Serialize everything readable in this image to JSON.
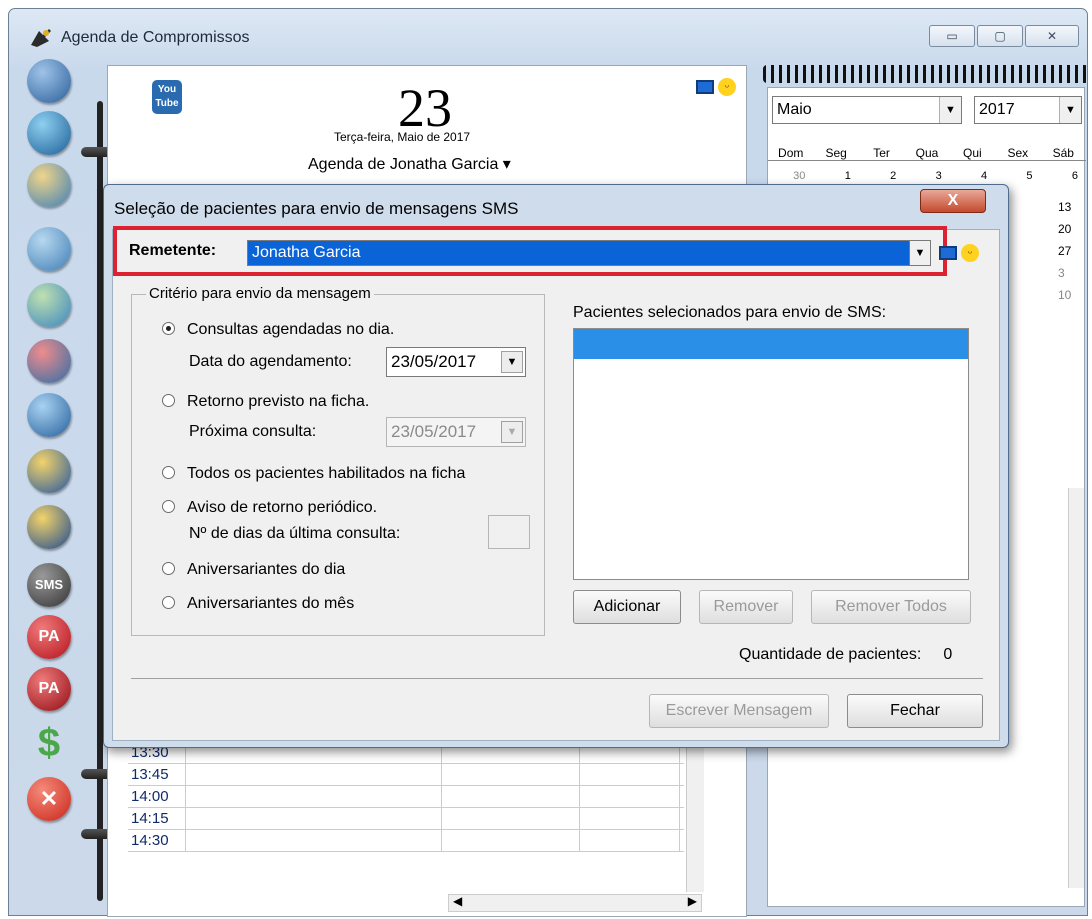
{
  "window": {
    "title": "Agenda de Compromissos",
    "controls": {
      "minimize": "▭",
      "maximize": "▢",
      "close": "✕"
    }
  },
  "toolbar": {
    "icons": [
      {
        "name": "address-book-icon",
        "label": ""
      },
      {
        "name": "clock-schedule-icon",
        "label": ""
      },
      {
        "name": "books-icon",
        "label": ""
      },
      {
        "name": "schedule-search-icon",
        "label": ""
      },
      {
        "name": "schedule-sync-icon",
        "label": ""
      },
      {
        "name": "schedule-delete-icon",
        "label": ""
      },
      {
        "name": "schedule-add-icon",
        "label": ""
      },
      {
        "name": "lock-book-icon",
        "label": ""
      },
      {
        "name": "lock-book-2-icon",
        "label": ""
      },
      {
        "name": "sms-icon",
        "label": "SMS"
      },
      {
        "name": "pa-icon",
        "label": "PA"
      },
      {
        "name": "pa-cancel-icon",
        "label": "PA"
      },
      {
        "name": "dollar-icon",
        "label": "$"
      },
      {
        "name": "close-app-icon",
        "label": "✕"
      }
    ]
  },
  "agenda": {
    "youtube": "You Tube",
    "day": "23",
    "date_text": "Terça-feira, Maio de 2017",
    "owner": "Agenda de Jonatha Garcia ▾",
    "times": [
      "13:30",
      "13:45",
      "14:00",
      "14:15",
      "14:30"
    ]
  },
  "calendar": {
    "month": "Maio",
    "year": "2017",
    "weekdays": [
      "Dom",
      "Seg",
      "Ter",
      "Qua",
      "Qui",
      "Sex",
      "Sáb"
    ],
    "week1": [
      "30",
      "1",
      "2",
      "3",
      "4",
      "5",
      "6"
    ],
    "right_col": [
      "13",
      "20",
      "27",
      "3",
      "10"
    ]
  },
  "dialog": {
    "title": "Seleção de pacientes para envio de mensagens SMS",
    "close": "X",
    "sender_label": "Remetente:",
    "sender_value": "Jonatha Garcia",
    "criteria_legend": "Critério para envio da mensagem",
    "opt_scheduled": "Consultas agendadas no dia.",
    "label_schedule_date": "Data do agendamento:",
    "schedule_date": "23/05/2017",
    "opt_return": "Retorno previsto na ficha.",
    "label_next": "Próxima consulta:",
    "next_date": "23/05/2017",
    "opt_all": "Todos os pacientes habilitados na ficha",
    "opt_periodic": "Aviso de retorno periódico.",
    "label_days": "Nº de dias da última consulta:",
    "opt_bday_day": "Aniversariantes do dia",
    "opt_bday_month": "Aniversariantes do mês",
    "patients_label": "Pacientes selecionados para envio de SMS:",
    "btn_add": "Adicionar",
    "btn_remove": "Remover",
    "btn_remove_all": "Remover Todos",
    "qty_label": "Quantidade de pacientes:",
    "qty_value": "0",
    "btn_write": "Escrever Mensagem",
    "btn_close": "Fechar"
  },
  "colors": {
    "highlight": "#dc2230",
    "selection": "#0a64d8"
  }
}
